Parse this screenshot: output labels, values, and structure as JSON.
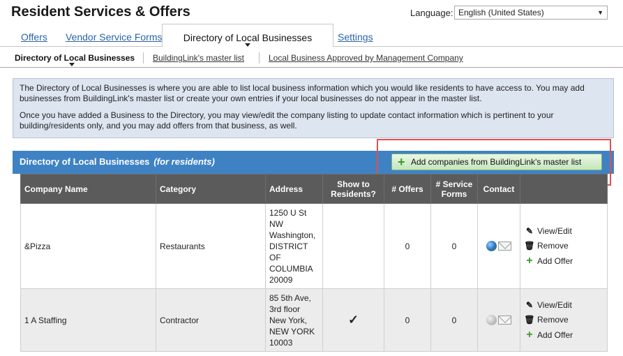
{
  "header": {
    "title": "Resident Services & Offers",
    "language_label": "Language:",
    "language_value": "English (United States)"
  },
  "tabs": [
    "Offers",
    "Vendor Service Forms",
    "Directory of Local Businesses",
    "Settings"
  ],
  "subtabs": [
    "Directory of Local Businesses",
    "BuildingLink's master list",
    "Local Business Approved by Management Company"
  ],
  "info": {
    "p1": "The Directory of Local Businesses is where you are able to list local business information which you would like residents to have access to. You may add businesses from BuildingLink's master list or create your own entries if your local businesses do not appear in the master list.",
    "p2": "Once you have added a Business to the Directory, you may view/edit the company listing to update contact information which is pertinent to your building/residents only, and you may add offers from that business, as well."
  },
  "directory": {
    "title": "Directory of Local Businesses",
    "subtitle": "(for residents)",
    "add_button": "Add companies from BuildingLink's master list"
  },
  "table": {
    "columns": [
      "Company Name",
      "Category",
      "Address",
      "Show to Residents?",
      "# Offers",
      "# Service Forms",
      "Contact",
      ""
    ],
    "rows": [
      {
        "company": "&Pizza",
        "category": "Restaurants",
        "address": "1250 U St NW Washington, DISTRICT OF COLUMBIA 20009",
        "show": "",
        "offers": "0",
        "forms": "0",
        "contact": "globe-icon"
      },
      {
        "company": "1 A Staffing",
        "category": "Contractor",
        "address": "85 5th Ave, 3rd floor New York, NEW YORK 10003",
        "show": "✓",
        "offers": "0",
        "forms": "0",
        "contact": "globe-icon-gray"
      }
    ],
    "actions": {
      "view": "View/Edit",
      "remove": "Remove",
      "add": "Add Offer"
    }
  },
  "colors": {
    "accent": "#3f82c4",
    "header_gray": "#5b5b5b",
    "highlight": "#e05050",
    "button_green": "#c4e6bd"
  }
}
